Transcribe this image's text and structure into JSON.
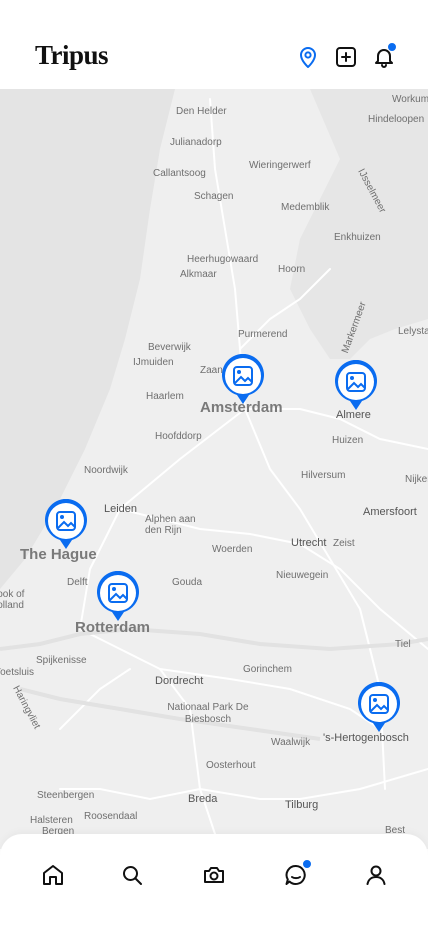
{
  "app": {
    "title": "Tripus"
  },
  "colors": {
    "accent": "#0a6cf0",
    "map_bg": "#efefef",
    "text": "#111111"
  },
  "header": {
    "icons": [
      "map-pin-icon",
      "add-post-icon",
      "bell-icon"
    ],
    "notification_dot": true
  },
  "map": {
    "cities_major": [
      "Amsterdam",
      "The Hague",
      "Rotterdam"
    ],
    "places": [
      "Den Helder",
      "Julianadorp",
      "Callantsoog",
      "Schagen",
      "Wieringerwerf",
      "Medemblik",
      "Enkhuizen",
      "Heerhugowaard",
      "Alkmaar",
      "Hoorn",
      "Purmerend",
      "Beverwijk",
      "IJmuiden",
      "Zaandam",
      "Haarlem",
      "Hoofddorp",
      "Almere",
      "Huizen",
      "Lelystad",
      "Hilversum",
      "Nijkerk",
      "Amersfoort",
      "Noordwijk",
      "Leiden",
      "Alphen aan den Rijn",
      "Woerden",
      "Utrecht",
      "Zeist",
      "Delft",
      "Gouda",
      "Nieuwegein",
      "Hook of Holland",
      "Spijkenisse",
      "Voetsluis",
      "Haringvliet",
      "Dordrecht",
      "Gorinchem",
      "Nationaal Park De Biesbosch",
      "Waalwijk",
      "'s-Hertogenbosch",
      "Oosterhout",
      "Steenbergen",
      "Breda",
      "Tilburg",
      "Halsteren",
      "Roosendaal",
      "Bergen",
      "Best",
      "Tiel",
      "Workum",
      "Hindeloopen",
      "IJsselmeer",
      "Markermeer"
    ],
    "photo_pins": [
      "Amsterdam",
      "Almere",
      "The Hague",
      "Rotterdam",
      "'s-Hertogenbosch"
    ]
  },
  "nav": {
    "items": [
      {
        "name": "home",
        "icon": "home-icon"
      },
      {
        "name": "search",
        "icon": "search-icon"
      },
      {
        "name": "camera",
        "icon": "camera-icon"
      },
      {
        "name": "messages",
        "icon": "chat-icon",
        "badge": true
      },
      {
        "name": "profile",
        "icon": "user-icon"
      }
    ]
  }
}
